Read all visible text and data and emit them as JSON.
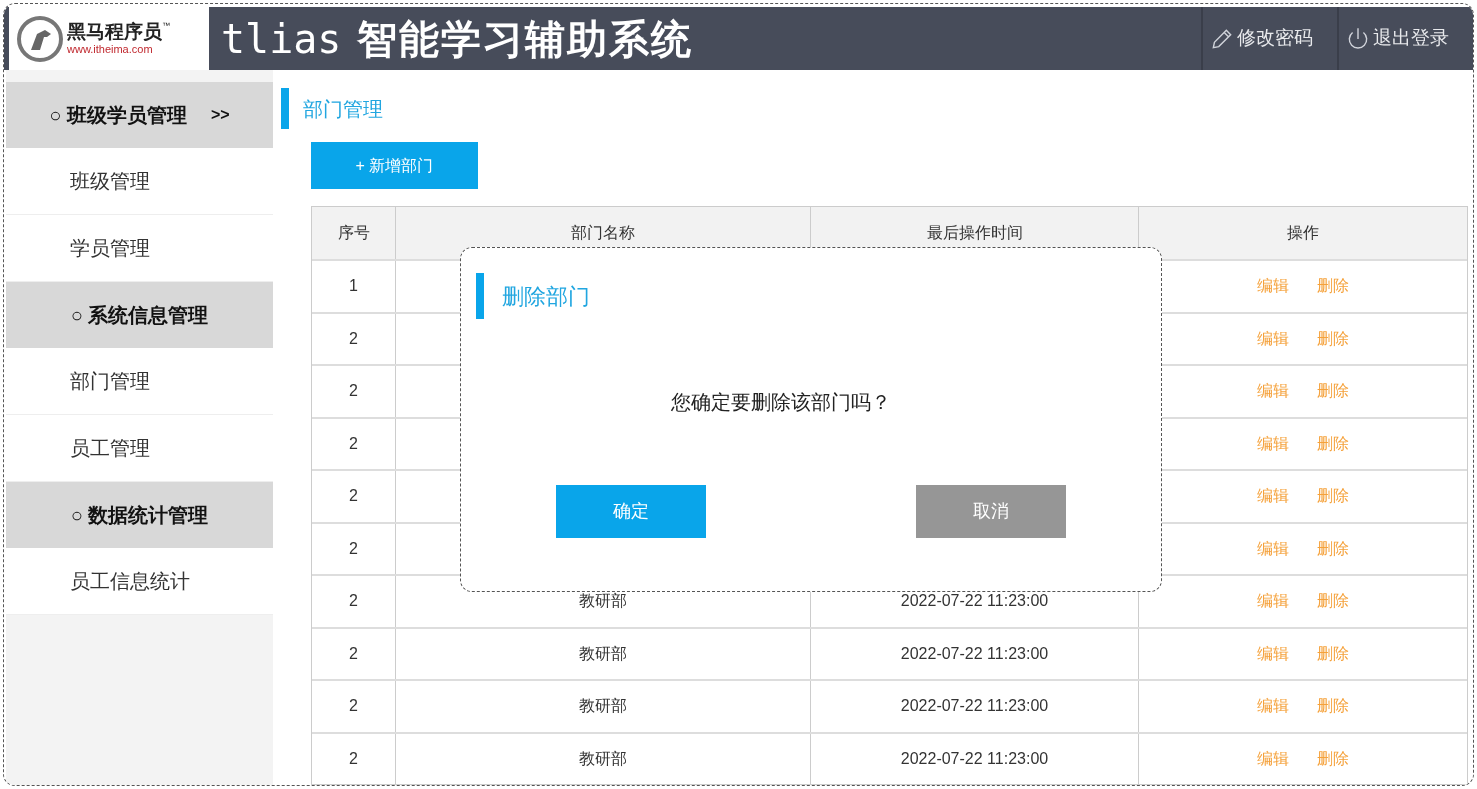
{
  "header": {
    "logo": {
      "name": "黑马程序员",
      "tm": "™",
      "url": "www.itheima.com"
    },
    "title_latin": "tlias",
    "title": "智能学习辅助系统",
    "actions": [
      {
        "kind": "edit",
        "label": "修改密码"
      },
      {
        "kind": "logout",
        "label": "退出登录"
      }
    ]
  },
  "sidebar": {
    "groups": [
      {
        "label": "○ 班级学员管理",
        "marker": ">>",
        "children": [
          {
            "label": "班级管理"
          },
          {
            "label": "学员管理"
          }
        ]
      },
      {
        "label": "○ 系统信息管理",
        "children": [
          {
            "label": "部门管理"
          },
          {
            "label": "员工管理"
          }
        ]
      },
      {
        "label": "○ 数据统计管理",
        "children": [
          {
            "label": "员工信息统计"
          }
        ]
      }
    ]
  },
  "page": {
    "title": "部门管理",
    "add_button": "+ 新增部门"
  },
  "table": {
    "columns": [
      "序号",
      "部门名称",
      "最后操作时间",
      "操作"
    ],
    "rows": [
      {
        "index": "1",
        "actions": [
          "编辑",
          "删除"
        ]
      },
      {
        "index": "2",
        "actions": [
          "编辑",
          "删除"
        ]
      },
      {
        "index": "2",
        "actions": [
          "编辑",
          "删除"
        ]
      },
      {
        "index": "2",
        "actions": [
          "编辑",
          "删除"
        ]
      },
      {
        "index": "2",
        "actions": [
          "编辑",
          "删除"
        ]
      },
      {
        "index": "2",
        "actions": [
          "编辑",
          "删除"
        ]
      },
      {
        "index": "2",
        "name": "教研部",
        "time": "2022-07-22 11:23:00",
        "actions": [
          "编辑",
          "删除"
        ]
      },
      {
        "index": "2",
        "name": "教研部",
        "time": "2022-07-22 11:23:00",
        "actions": [
          "编辑",
          "删除"
        ]
      },
      {
        "index": "2",
        "name": "教研部",
        "time": "2022-07-22 11:23:00",
        "actions": [
          "编辑",
          "删除"
        ]
      },
      {
        "index": "2",
        "name": "教研部",
        "time": "2022-07-22 11:23:00",
        "actions": [
          "编辑",
          "删除"
        ]
      }
    ]
  },
  "dialog": {
    "title": "删除部门",
    "message": "您确定要删除该部门吗？",
    "buttons": [
      {
        "kind": "primary",
        "label": "确定"
      },
      {
        "kind": "secondary",
        "label": "取消"
      }
    ]
  }
}
